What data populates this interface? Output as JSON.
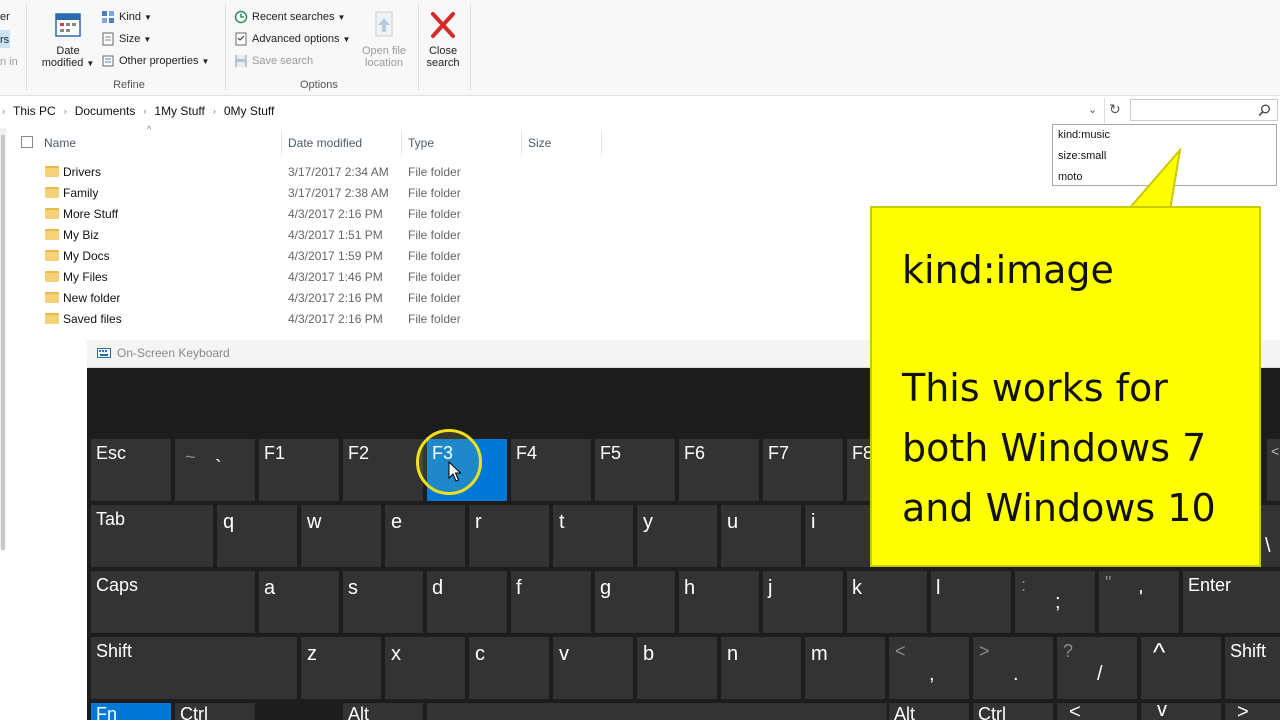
{
  "ribbon": {
    "left_partial": [
      "er",
      "rs",
      "n in"
    ],
    "date_modified": [
      "Date",
      "modified"
    ],
    "kind": "Kind",
    "size": "Size",
    "other_properties": "Other properties",
    "refine_label": "Refine",
    "recent_searches": "Recent searches",
    "advanced_options": "Advanced options",
    "save_search": "Save search",
    "open_file_location": [
      "Open file",
      "location"
    ],
    "options_label": "Options",
    "close_search": [
      "Close",
      "search"
    ]
  },
  "address": {
    "crumbs": [
      "This PC",
      "Documents",
      "1My Stuff",
      "0My Stuff"
    ]
  },
  "search_dropdown": [
    "kind:music",
    "size:small",
    "moto"
  ],
  "columns": {
    "name": "Name",
    "date": "Date modified",
    "type": "Type",
    "size": "Size"
  },
  "files": [
    {
      "name": "Drivers",
      "date": "3/17/2017 2:34 AM",
      "type": "File folder"
    },
    {
      "name": "Family",
      "date": "3/17/2017 2:38 AM",
      "type": "File folder"
    },
    {
      "name": "More Stuff",
      "date": "4/3/2017 2:16 PM",
      "type": "File folder"
    },
    {
      "name": "My Biz",
      "date": "4/3/2017 1:51 PM",
      "type": "File folder"
    },
    {
      "name": "My Docs",
      "date": "4/3/2017 1:59 PM",
      "type": "File folder"
    },
    {
      "name": "My Files",
      "date": "4/3/2017 1:46 PM",
      "type": "File folder"
    },
    {
      "name": "New folder",
      "date": "4/3/2017 2:16 PM",
      "type": "File folder"
    },
    {
      "name": "Saved files",
      "date": "4/3/2017 2:16 PM",
      "type": "File folder"
    }
  ],
  "osk": {
    "title": "On-Screen Keyboard",
    "row1": {
      "esc": "Esc",
      "tilde": "~",
      "backtick": "`",
      "f1": "F1",
      "f2": "F2",
      "f3": "F3",
      "f4": "F4",
      "f5": "F5",
      "f6": "F6",
      "f7": "F7",
      "f8": "F8",
      "lt": "<"
    },
    "row2": {
      "tab": "Tab",
      "keys": [
        "q",
        "w",
        "e",
        "r",
        "t",
        "y",
        "u",
        "i"
      ],
      "backslash": "\\"
    },
    "row3": {
      "caps": "Caps",
      "keys": [
        "a",
        "s",
        "d",
        "f",
        "g",
        "h",
        "j",
        "k",
        "l"
      ],
      "colon": ":",
      "semicolon": ";",
      "quote": "\"",
      "apos": "'",
      "enter": "Enter"
    },
    "row4": {
      "shift_l": "Shift",
      "keys": [
        "z",
        "x",
        "c",
        "v",
        "b",
        "n",
        "m"
      ],
      "lt": "<",
      "comma": ",",
      "gt": ">",
      "period": ".",
      "question": "?",
      "slash": "/",
      "up": "^",
      "shift_r": "Shift"
    },
    "row5": {
      "fn": "Fn",
      "ctrl_l": "Ctrl",
      "alt_l": "Alt",
      "alt_r": "Alt",
      "ctrl_r": "Ctrl",
      "left": "<",
      "down": "v",
      "right": ">"
    }
  },
  "callout": {
    "line1": "kind:image",
    "line2": "This works for",
    "line3": "both Windows 7",
    "line4": "and Windows 10"
  },
  "colors": {
    "accent": "#0078d7",
    "callout": "#ffff00",
    "key": "#333333"
  }
}
